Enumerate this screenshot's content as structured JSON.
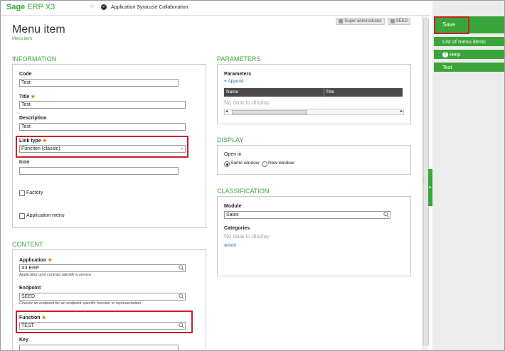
{
  "topbar": {
    "logo_brand": "Sage",
    "logo_product": "ERP X3",
    "app_title": "Application Syracuse Collaboration"
  },
  "badges": {
    "user": "Super administrator",
    "endpoint": "SEED"
  },
  "page": {
    "title": "Menu item",
    "breadcrumb": "Menu item"
  },
  "information": {
    "section_title": "INFORMATION",
    "code_label": "Code",
    "code_value": "Test",
    "title_label": "Title",
    "title_value": "Test",
    "description_label": "Description",
    "description_value": "Test",
    "link_type_label": "Link type",
    "link_type_value": "Function (classic)",
    "icon_label": "Icon",
    "icon_value": "",
    "factory_label": "Factory",
    "application_menu_label": "Application menu",
    "required_mark": "★"
  },
  "content": {
    "section_title": "CONTENT",
    "application_label": "Application",
    "application_value": "X3 ERP",
    "application_hint": "Application and contract identify a service",
    "endpoint_label": "Endpoint",
    "endpoint_value": "SEED",
    "endpoint_hint": "Choose an endpoint for an endpoint specific function or representation",
    "function_label": "Function",
    "function_value": "TEST",
    "key_label": "Key",
    "key_value": ""
  },
  "parameters": {
    "section_title": "PARAMETERS",
    "label": "Parameters",
    "append": "Append",
    "columns": [
      "Name",
      "Title"
    ],
    "empty": "No data to display"
  },
  "display": {
    "section_title": "DISPLAY",
    "open_in_label": "Open in",
    "option_same": "Same window",
    "option_new": "New window"
  },
  "classification": {
    "section_title": "CLASSIFICATION",
    "module_label": "Module",
    "module_value": "Sales",
    "categories_label": "Categories",
    "categories_empty": "No data to display",
    "add": "Add"
  },
  "actions": {
    "save": "Save",
    "list": "List of menu items",
    "help": "Help",
    "test": "Test"
  },
  "colors": {
    "accent": "#3aa63a",
    "highlight": "#c8202a"
  }
}
